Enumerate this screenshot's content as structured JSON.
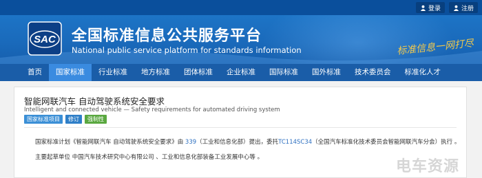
{
  "topbar": {
    "login": "登录",
    "register": "注册"
  },
  "header": {
    "logo_text": "SAC",
    "title_cn": "全国标准信息公共服务平台",
    "title_en": "National public service platform  for standards information",
    "slogan": "标准信息一网打尽"
  },
  "nav": {
    "items": [
      "首页",
      "国家标准",
      "行业标准",
      "地方标准",
      "团体标准",
      "企业标准",
      "国际标准",
      "国外标准",
      "技术委员会",
      "标准化人才"
    ],
    "active_index": 1
  },
  "standard": {
    "title_cn": "智能网联汽车 自动驾驶系统安全要求",
    "title_en": "Intelligent and connected vehicle — Safety requirements for automated driving system",
    "tags": [
      "国家标准项目",
      "修订",
      "强制性"
    ],
    "para1": {
      "prefix": "国家标准计划《智能网联汽车 自动驾驶系统安全要求》由 ",
      "number": "339",
      "mid": "（工业和信息化部）提出，委托",
      "committee_code": "TC114SC34",
      "suffix": "（全国汽车标准化技术委员会智能网联汽车分会）执行 。"
    },
    "para2": "主要起草单位 中国汽车技术研究中心有限公司 、工业和信息化部装备工业发展中心等 。"
  },
  "watermark": "电车资源",
  "colors": {
    "topbar": "#0a4f9c",
    "nav": "#1a5da8",
    "nav_active": "#3a8be0",
    "link": "#2c6fc0"
  }
}
